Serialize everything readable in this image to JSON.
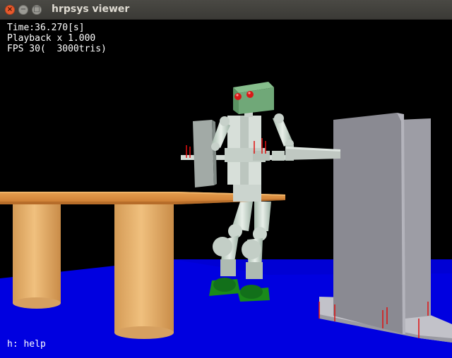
{
  "window": {
    "title": "hrpsys viewer",
    "controls": {
      "close": "×",
      "minimize": "−",
      "maximize": "□"
    }
  },
  "hud": {
    "time": "Time:36.270[s]",
    "playback": "Playback x 1.000",
    "fps": "FPS 30(  3000tris)",
    "help": "h: help"
  },
  "colors": {
    "background": "#000000",
    "floor": "#0000e0",
    "table_top": "#d98a3c",
    "table_legs": "#e2aa66",
    "robot_body": "#cfd8d0",
    "robot_head": "#6fa878",
    "robot_eyes": "#d81818",
    "robot_feet": "#157a15",
    "walls": "#8d8d94",
    "force_markers": "#e01010"
  }
}
